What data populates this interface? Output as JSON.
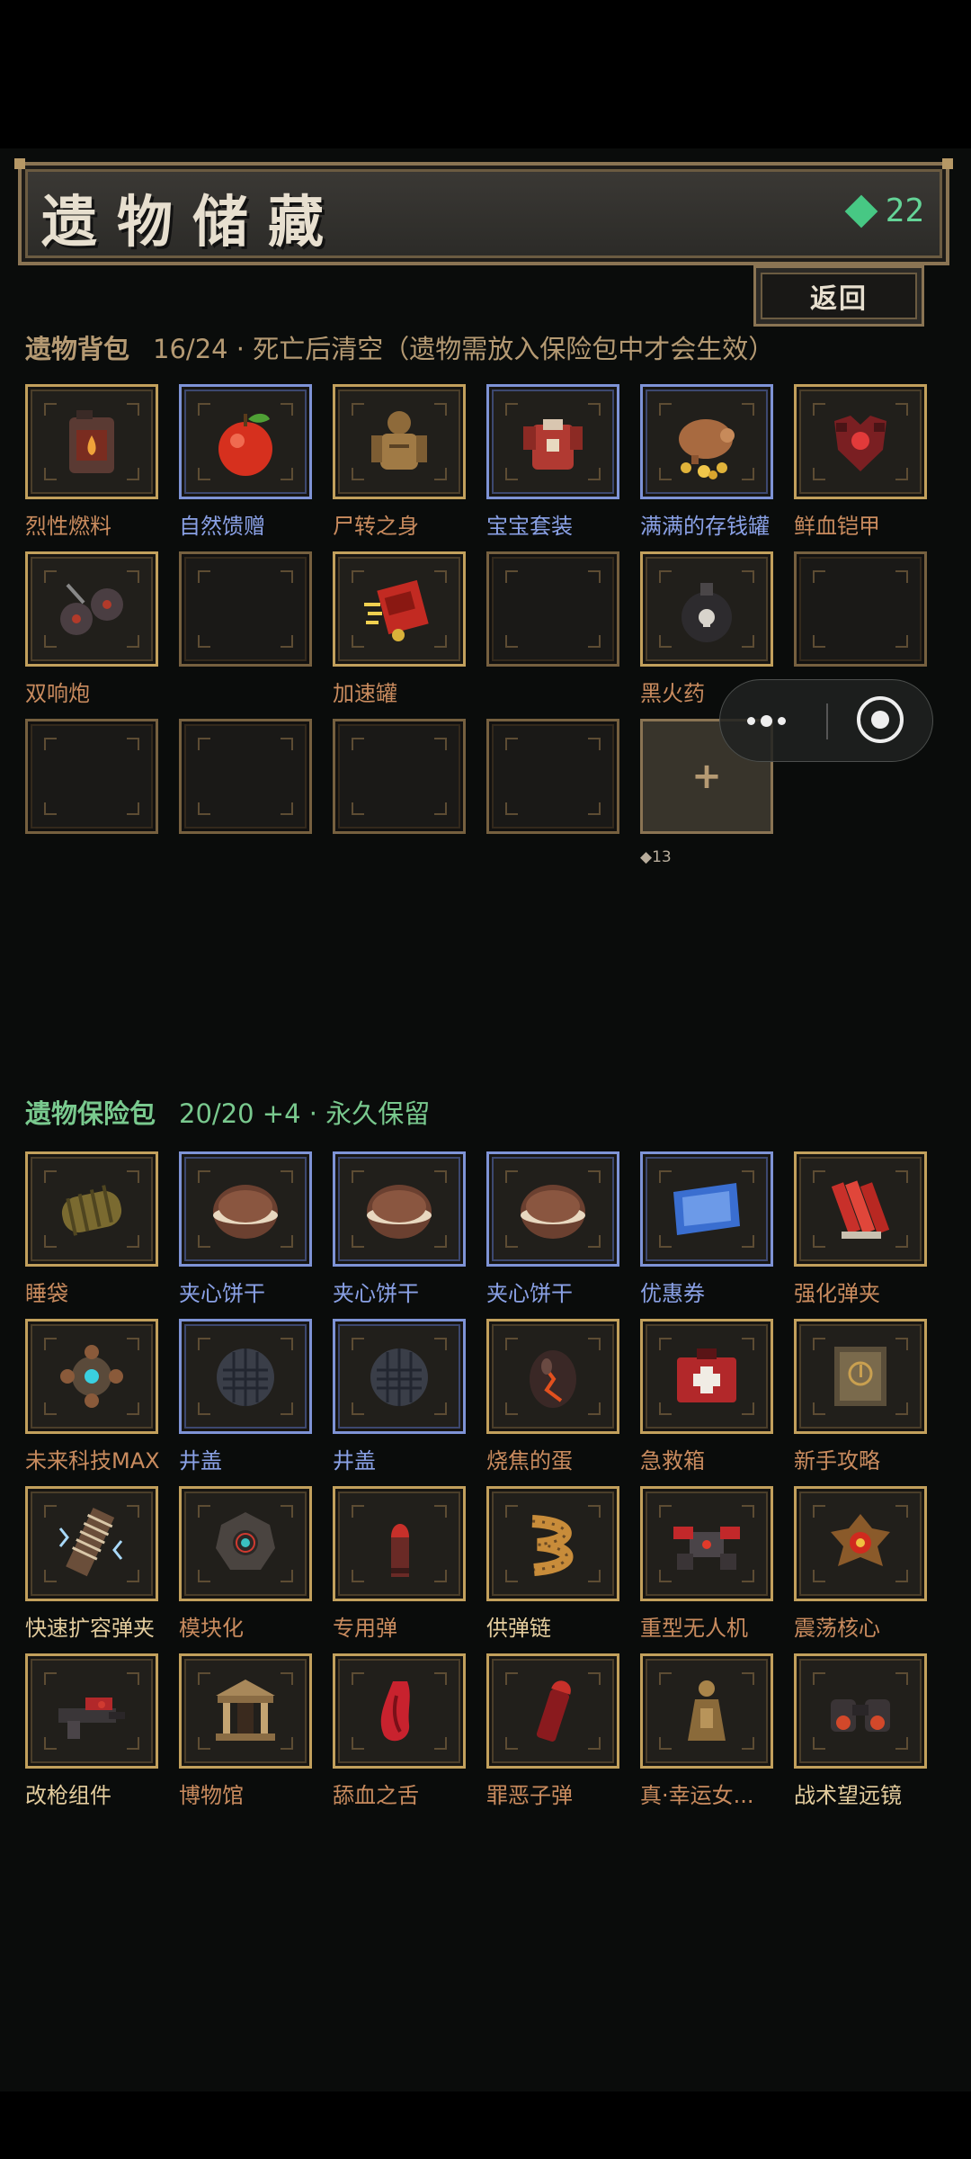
{
  "header": {
    "title": "遗物储藏",
    "gems": "22"
  },
  "back_label": "返回",
  "bag": {
    "title": "遗物背包",
    "info": "16/24 · 死亡后清空（遗物需放入保险包中才会生效）",
    "items": [
      {
        "label": "烈性燃料",
        "rarity": "gold"
      },
      {
        "label": "自然馈赠",
        "rarity": "blue"
      },
      {
        "label": "尸转之身",
        "rarity": "gold"
      },
      {
        "label": "宝宝套装",
        "rarity": "blue"
      },
      {
        "label": "满满的存钱罐",
        "rarity": "blue"
      },
      {
        "label": "鲜血铠甲",
        "rarity": "gold"
      },
      {
        "label": "双响炮",
        "rarity": "gold"
      },
      {
        "label": "",
        "rarity": "empty"
      },
      {
        "label": "加速罐",
        "rarity": "gold"
      },
      {
        "label": "",
        "rarity": "empty"
      },
      {
        "label": "黑火药",
        "rarity": "gold"
      },
      {
        "label": "",
        "rarity": "empty"
      },
      {
        "label": "",
        "rarity": "empty"
      },
      {
        "label": "",
        "rarity": "empty"
      },
      {
        "label": "",
        "rarity": "empty"
      },
      {
        "label": "",
        "rarity": "empty"
      }
    ],
    "add_slot": {
      "plus": "+",
      "cost": "◆13"
    }
  },
  "vault": {
    "title": "遗物保险包",
    "info": "20/20 +4 · 永久保留",
    "items": [
      {
        "label": "睡袋",
        "rarity": "gold"
      },
      {
        "label": "夹心饼干",
        "rarity": "blue"
      },
      {
        "label": "夹心饼干",
        "rarity": "blue"
      },
      {
        "label": "夹心饼干",
        "rarity": "blue"
      },
      {
        "label": "优惠券",
        "rarity": "blue"
      },
      {
        "label": "强化弹夹",
        "rarity": "gold"
      },
      {
        "label": "未来科技MAX",
        "rarity": "gold"
      },
      {
        "label": "井盖",
        "rarity": "blue"
      },
      {
        "label": "井盖",
        "rarity": "blue"
      },
      {
        "label": "烧焦的蛋",
        "rarity": "gold"
      },
      {
        "label": "急救箱",
        "rarity": "gold"
      },
      {
        "label": "新手攻略",
        "rarity": "gold"
      },
      {
        "label": "快速扩容弹夹",
        "rarity": "gold"
      },
      {
        "label": "模块化",
        "rarity": "gold"
      },
      {
        "label": "专用弹",
        "rarity": "gold"
      },
      {
        "label": "供弹链",
        "rarity": "gold"
      },
      {
        "label": "重型无人机",
        "rarity": "gold"
      },
      {
        "label": "震荡核心",
        "rarity": "gold"
      },
      {
        "label": "改枪组件",
        "rarity": "gold"
      },
      {
        "label": "博物馆",
        "rarity": "gold"
      },
      {
        "label": "舔血之舌",
        "rarity": "gold"
      },
      {
        "label": "罪恶子弹",
        "rarity": "gold"
      },
      {
        "label": "真·幸运女...",
        "rarity": "gold"
      },
      {
        "label": "战术望远镜",
        "rarity": "gold"
      }
    ]
  },
  "colors": {
    "gold_frame": "#c2a05c",
    "blue_frame": "#7e93d6",
    "gem": "#47c884",
    "vault_title": "#79c98e"
  },
  "icons": {
    "bag": [
      "fuel-can-icon",
      "apple-icon",
      "zombie-body-icon",
      "baby-suit-icon",
      "piggy-bank-icon",
      "blood-armor-icon",
      "double-bomb-icon",
      "",
      "speed-can-icon",
      "",
      "black-powder-icon",
      "",
      "",
      "",
      "",
      ""
    ],
    "vault": [
      "sleeping-bag-icon",
      "sandwich-cookie-icon",
      "sandwich-cookie-icon",
      "sandwich-cookie-icon",
      "coupon-icon",
      "ammo-clip-icon",
      "future-tech-icon",
      "manhole-cover-icon",
      "manhole-cover-icon",
      "burnt-egg-icon",
      "first-aid-kit-icon",
      "guide-book-icon",
      "extended-mag-icon",
      "module-icon",
      "special-bullet-icon",
      "ammo-belt-icon",
      "heavy-drone-icon",
      "shock-core-icon",
      "gun-mod-icon",
      "museum-icon",
      "blood-tongue-icon",
      "sin-bullet-icon",
      "lucky-goddess-icon",
      "binoculars-icon"
    ]
  }
}
